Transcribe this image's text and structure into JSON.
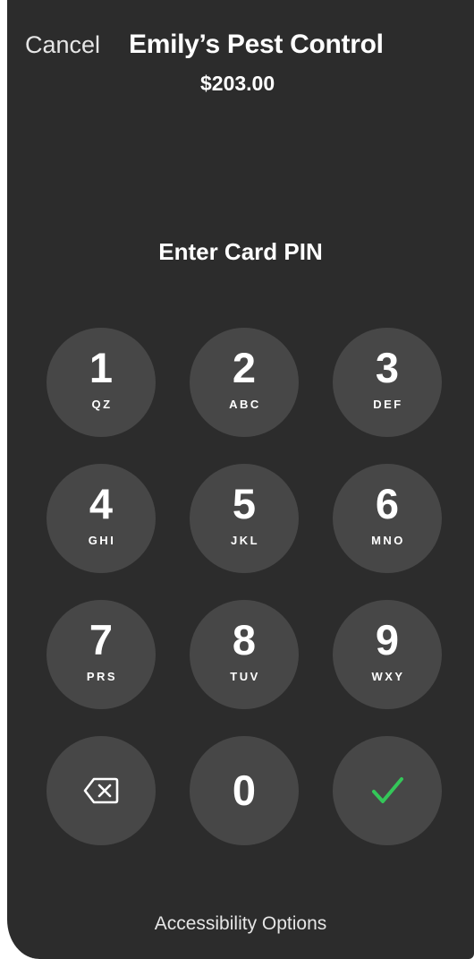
{
  "header": {
    "cancel_label": "Cancel",
    "merchant_name": "Emily’s Pest Control",
    "amount": "$203.00"
  },
  "prompt": "Enter Card PIN",
  "keypad": {
    "keys": [
      {
        "digit": "1",
        "letters": "QZ"
      },
      {
        "digit": "2",
        "letters": "ABC"
      },
      {
        "digit": "3",
        "letters": "DEF"
      },
      {
        "digit": "4",
        "letters": "GHI"
      },
      {
        "digit": "5",
        "letters": "JKL"
      },
      {
        "digit": "6",
        "letters": "MNO"
      },
      {
        "digit": "7",
        "letters": "PRS"
      },
      {
        "digit": "8",
        "letters": "TUV"
      },
      {
        "digit": "9",
        "letters": "WXY"
      }
    ],
    "zero": "0",
    "backspace_icon": "backspace-icon",
    "confirm_icon": "checkmark-icon",
    "confirm_color": "#34c759"
  },
  "footer": {
    "accessibility_label": "Accessibility Options"
  }
}
